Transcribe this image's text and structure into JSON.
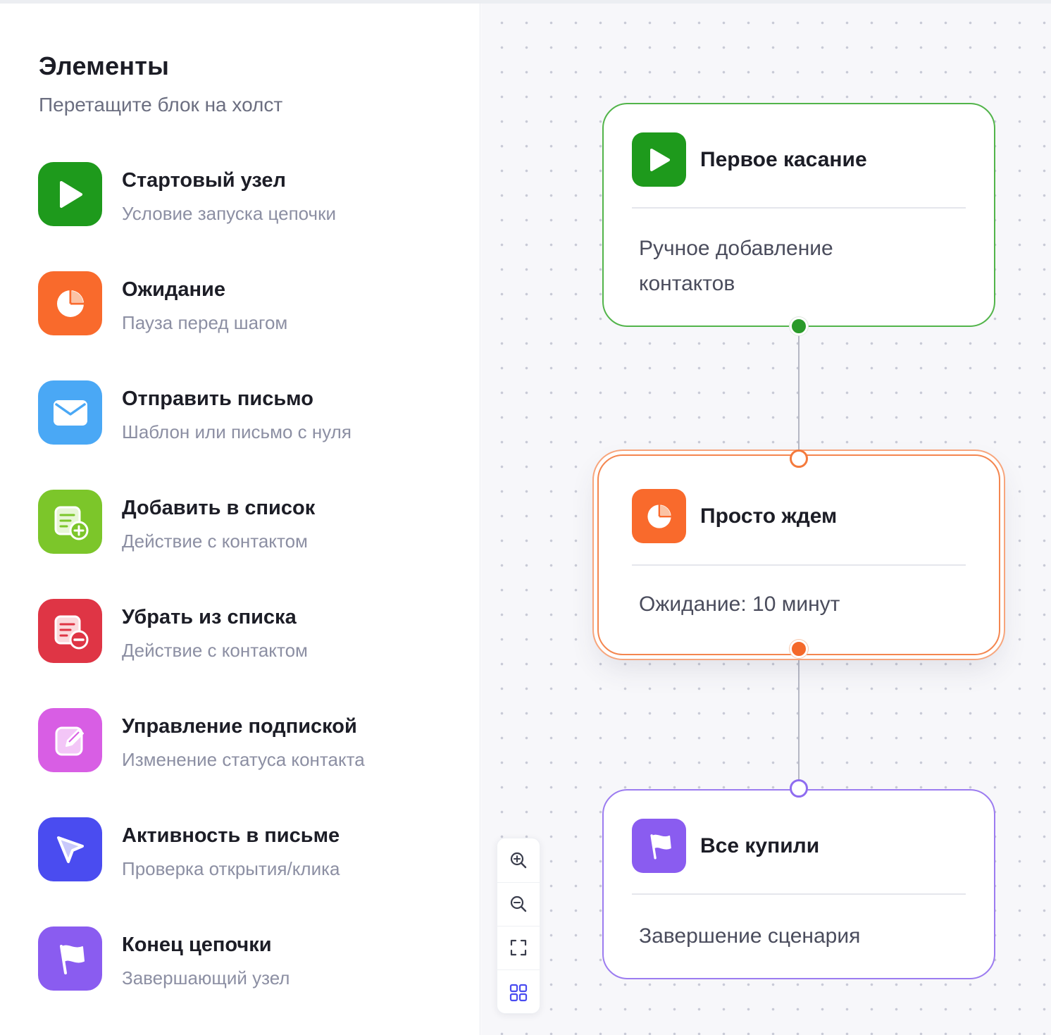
{
  "sidebar": {
    "title": "Элементы",
    "subtitle": "Перетащите блок на холст",
    "items": [
      {
        "name": "Стартовый узел",
        "desc": "Условие запуска цепочки",
        "icon": "play-icon",
        "color": "#1e9a1c"
      },
      {
        "name": "Ожидание",
        "desc": "Пауза перед шагом",
        "icon": "clock-pie-icon",
        "color": "#f96a2c"
      },
      {
        "name": "Отправить письмо",
        "desc": "Шаблон или письмо с нуля",
        "icon": "envelope-icon",
        "color": "#4aa8f5"
      },
      {
        "name": "Добавить в список",
        "desc": "Действие с контактом",
        "icon": "list-add-icon",
        "color": "#7cc62a"
      },
      {
        "name": "Убрать из списка",
        "desc": "Действие с контактом",
        "icon": "list-remove-icon",
        "color": "#df3545"
      },
      {
        "name": "Управление подпиской",
        "desc": "Изменение статуса контакта",
        "icon": "edit-pencil-icon",
        "color": "#d85ee4"
      },
      {
        "name": "Активность в письме",
        "desc": "Проверка открытия/клика",
        "icon": "cursor-pointer-icon",
        "color": "#4a4cf0"
      },
      {
        "name": "Конец цепочки",
        "desc": "Завершающий узел",
        "icon": "flag-icon",
        "color": "#8a5cf0"
      }
    ]
  },
  "canvas": {
    "nodes": [
      {
        "title": "Первое касание",
        "body": "Ручное добавление контактов",
        "icon": "play-icon",
        "color": "#1e9a1c"
      },
      {
        "title": "Просто ждем",
        "body": "Ожидание: 10 минут",
        "icon": "clock-pie-icon",
        "color": "#f96a2c"
      },
      {
        "title": "Все купили",
        "body": "Завершение сценария",
        "icon": "flag-icon",
        "color": "#8a5cf0"
      }
    ],
    "controls": [
      "zoom-in-icon",
      "zoom-out-icon",
      "fit-view-icon",
      "grid-icon"
    ]
  }
}
